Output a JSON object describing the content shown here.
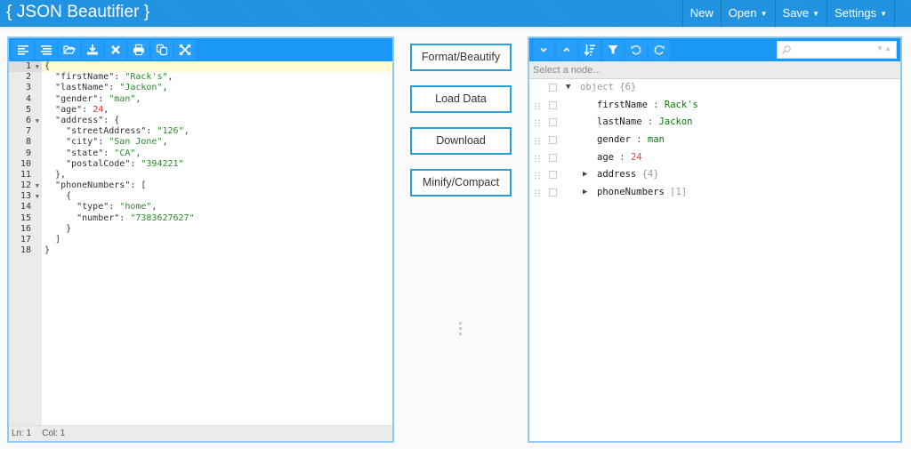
{
  "header": {
    "title": "{ JSON Beautifier }",
    "nav": [
      {
        "label": "New",
        "has_caret": false
      },
      {
        "label": "Open",
        "has_caret": true
      },
      {
        "label": "Save",
        "has_caret": true
      },
      {
        "label": "Settings",
        "has_caret": true
      }
    ],
    "caret_glyph": "▼",
    "brand_color": "#1e90e0"
  },
  "editor": {
    "toolbar": [
      "format-icon",
      "compact-icon",
      "open-file-icon",
      "download-icon",
      "clear-icon",
      "print-icon",
      "copy-icon",
      "fullscreen-icon"
    ],
    "lines": [
      {
        "num": "1",
        "fold": true,
        "active": true
      },
      {
        "num": "2"
      },
      {
        "num": "3"
      },
      {
        "num": "4"
      },
      {
        "num": "5"
      },
      {
        "num": "6",
        "fold": true
      },
      {
        "num": "7"
      },
      {
        "num": "8"
      },
      {
        "num": "9"
      },
      {
        "num": "10"
      },
      {
        "num": "11"
      },
      {
        "num": "12",
        "fold": true
      },
      {
        "num": "13",
        "fold": true
      },
      {
        "num": "14"
      },
      {
        "num": "15"
      },
      {
        "num": "16"
      },
      {
        "num": "17"
      },
      {
        "num": "18"
      }
    ],
    "code": [
      [
        {
          "t": "p",
          "v": "{"
        }
      ],
      [
        {
          "t": "p",
          "v": "  "
        },
        {
          "t": "k",
          "v": "\"firstName\""
        },
        {
          "t": "p",
          "v": ": "
        },
        {
          "t": "s",
          "v": "\"Rack's\""
        },
        {
          "t": "p",
          "v": ","
        }
      ],
      [
        {
          "t": "p",
          "v": "  "
        },
        {
          "t": "k",
          "v": "\"lastName\""
        },
        {
          "t": "p",
          "v": ": "
        },
        {
          "t": "s",
          "v": "\"Jackon\""
        },
        {
          "t": "p",
          "v": ","
        }
      ],
      [
        {
          "t": "p",
          "v": "  "
        },
        {
          "t": "k",
          "v": "\"gender\""
        },
        {
          "t": "p",
          "v": ": "
        },
        {
          "t": "s",
          "v": "\"man\""
        },
        {
          "t": "p",
          "v": ","
        }
      ],
      [
        {
          "t": "p",
          "v": "  "
        },
        {
          "t": "k",
          "v": "\"age\""
        },
        {
          "t": "p",
          "v": ": "
        },
        {
          "t": "n",
          "v": "24"
        },
        {
          "t": "p",
          "v": ","
        }
      ],
      [
        {
          "t": "p",
          "v": "  "
        },
        {
          "t": "k",
          "v": "\"address\""
        },
        {
          "t": "p",
          "v": ": {"
        }
      ],
      [
        {
          "t": "p",
          "v": "    "
        },
        {
          "t": "k",
          "v": "\"streetAddress\""
        },
        {
          "t": "p",
          "v": ": "
        },
        {
          "t": "s",
          "v": "\"126\""
        },
        {
          "t": "p",
          "v": ","
        }
      ],
      [
        {
          "t": "p",
          "v": "    "
        },
        {
          "t": "k",
          "v": "\"city\""
        },
        {
          "t": "p",
          "v": ": "
        },
        {
          "t": "s",
          "v": "\"San Jone\""
        },
        {
          "t": "p",
          "v": ","
        }
      ],
      [
        {
          "t": "p",
          "v": "    "
        },
        {
          "t": "k",
          "v": "\"state\""
        },
        {
          "t": "p",
          "v": ": "
        },
        {
          "t": "s",
          "v": "\"CA\""
        },
        {
          "t": "p",
          "v": ","
        }
      ],
      [
        {
          "t": "p",
          "v": "    "
        },
        {
          "t": "k",
          "v": "\"postalCode\""
        },
        {
          "t": "p",
          "v": ": "
        },
        {
          "t": "s",
          "v": "\"394221\""
        }
      ],
      [
        {
          "t": "p",
          "v": "  },"
        }
      ],
      [
        {
          "t": "p",
          "v": "  "
        },
        {
          "t": "k",
          "v": "\"phoneNumbers\""
        },
        {
          "t": "p",
          "v": ": ["
        }
      ],
      [
        {
          "t": "p",
          "v": "    {"
        }
      ],
      [
        {
          "t": "p",
          "v": "      "
        },
        {
          "t": "k",
          "v": "\"type\""
        },
        {
          "t": "p",
          "v": ": "
        },
        {
          "t": "s",
          "v": "\"home\""
        },
        {
          "t": "p",
          "v": ","
        }
      ],
      [
        {
          "t": "p",
          "v": "      "
        },
        {
          "t": "k",
          "v": "\"number\""
        },
        {
          "t": "p",
          "v": ": "
        },
        {
          "t": "s",
          "v": "\"7383627627\""
        }
      ],
      [
        {
          "t": "p",
          "v": "    }"
        }
      ],
      [
        {
          "t": "p",
          "v": "  ]"
        }
      ],
      [
        {
          "t": "p",
          "v": "}"
        }
      ]
    ],
    "status": {
      "line": "Ln: 1",
      "col": "Col: 1"
    }
  },
  "actions": {
    "format": "Format/Beautify",
    "load": "Load Data",
    "download": "Download",
    "minify": "Minify/Compact"
  },
  "tree": {
    "toolbar": [
      "expand-all-icon",
      "collapse-all-icon",
      "sort-icon",
      "filter-icon",
      "undo-icon",
      "redo-icon"
    ],
    "search": {
      "value": "",
      "placeholder": ""
    },
    "navbar_text": "Select a node...",
    "nodes": [
      {
        "type": "root",
        "expander": "▼",
        "field": "object",
        "meta": "{6}",
        "draggable": false
      },
      {
        "type": "leaf",
        "field": "firstName",
        "sep": ":",
        "value": "Rack's",
        "vtype": "string"
      },
      {
        "type": "leaf",
        "field": "lastName",
        "sep": ":",
        "value": "Jackon",
        "vtype": "string"
      },
      {
        "type": "leaf",
        "field": "gender",
        "sep": ":",
        "value": "man",
        "vtype": "string"
      },
      {
        "type": "leaf",
        "field": "age",
        "sep": " :",
        "value": "24",
        "vtype": "number"
      },
      {
        "type": "branch",
        "expander": "▶",
        "field": "address",
        "meta": "{4}"
      },
      {
        "type": "branch",
        "expander": "▶",
        "field": "phoneNumbers",
        "meta": "[1]"
      }
    ]
  }
}
